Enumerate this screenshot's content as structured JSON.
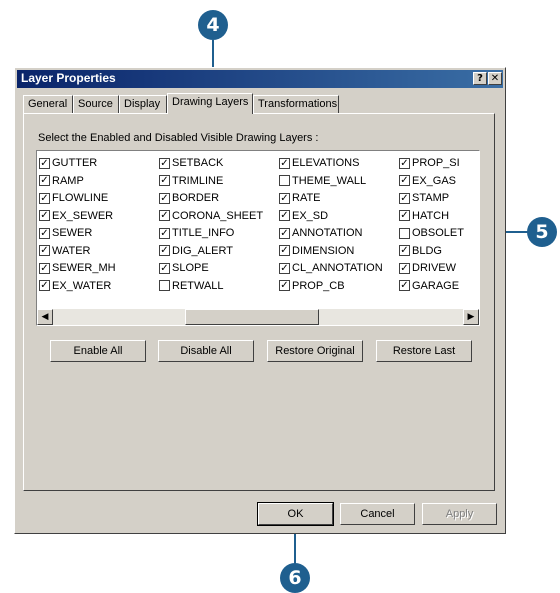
{
  "callouts": {
    "tab": "4",
    "list": "5",
    "ok": "6"
  },
  "window": {
    "title": "Layer Properties",
    "help_label": "?",
    "close_label": "✕"
  },
  "tabs": [
    "General",
    "Source",
    "Display",
    "Drawing Layers",
    "Transformations"
  ],
  "active_tab": "Drawing Layers",
  "instruction": "Select the Enabled and Disabled Visible Drawing  Layers :",
  "layers": {
    "col1": [
      {
        "label": "GUTTER",
        "checked": true
      },
      {
        "label": "RAMP",
        "checked": true
      },
      {
        "label": "FLOWLINE",
        "checked": true
      },
      {
        "label": "EX_SEWER",
        "checked": true
      },
      {
        "label": "SEWER",
        "checked": true
      },
      {
        "label": "WATER",
        "checked": true
      },
      {
        "label": "SEWER_MH",
        "checked": true
      },
      {
        "label": "EX_WATER",
        "checked": true
      }
    ],
    "col2": [
      {
        "label": "SETBACK",
        "checked": true
      },
      {
        "label": "TRIMLINE",
        "checked": true
      },
      {
        "label": "BORDER",
        "checked": true
      },
      {
        "label": "CORONA_SHEET",
        "checked": true
      },
      {
        "label": "TITLE_INFO",
        "checked": true
      },
      {
        "label": "DIG_ALERT",
        "checked": true
      },
      {
        "label": "SLOPE",
        "checked": true
      },
      {
        "label": "RETWALL",
        "checked": false
      }
    ],
    "col3": [
      {
        "label": "ELEVATIONS",
        "checked": true
      },
      {
        "label": "THEME_WALL",
        "checked": false
      },
      {
        "label": "RATE",
        "checked": true
      },
      {
        "label": "EX_SD",
        "checked": true
      },
      {
        "label": "ANNOTATION",
        "checked": true
      },
      {
        "label": "DIMENSION",
        "checked": true
      },
      {
        "label": "CL_ANNOTATION",
        "checked": true
      },
      {
        "label": "PROP_CB",
        "checked": true
      }
    ],
    "col4": [
      {
        "label": "PROP_SI",
        "checked": true
      },
      {
        "label": "EX_GAS",
        "checked": true
      },
      {
        "label": "STAMP",
        "checked": true
      },
      {
        "label": "HATCH",
        "checked": true
      },
      {
        "label": "OBSOLET",
        "checked": false
      },
      {
        "label": "BLDG",
        "checked": true
      },
      {
        "label": "DRIVEW",
        "checked": true
      },
      {
        "label": "GARAGE",
        "checked": true
      }
    ]
  },
  "scroll": {
    "left": "◀",
    "right": "▶"
  },
  "actions": {
    "enable_all": "Enable All",
    "disable_all": "Disable All",
    "restore_original": "Restore Original",
    "restore_last": "Restore Last"
  },
  "footer": {
    "ok": "OK",
    "cancel": "Cancel",
    "apply": "Apply"
  }
}
